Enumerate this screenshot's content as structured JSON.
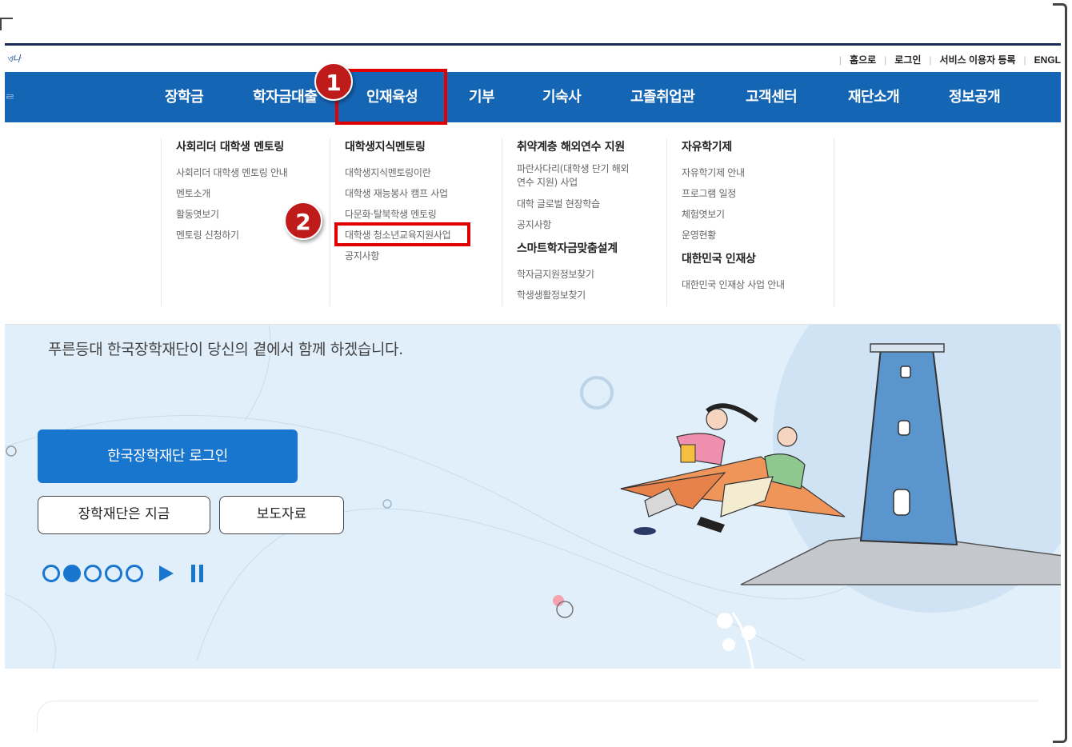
{
  "util_links": [
    "홈으로",
    "로그인",
    "서비스 이용자 등록",
    "ENGL"
  ],
  "logo_fragment": "ଏ나",
  "gnb": {
    "left_fragment": "ᄅ",
    "items": [
      "장학금",
      "학자금대출",
      "인재육성",
      "기부",
      "기숙사",
      "고졸취업관",
      "고객센터",
      "재단소개",
      "정보공개"
    ]
  },
  "mega": {
    "col1": {
      "title": "사회리더 대학생 멘토링",
      "links": [
        "사회리더 대학생 멘토링 안내",
        "멘토소개",
        "활동엿보기",
        "멘토링 신청하기"
      ]
    },
    "col2": {
      "title": "대학생지식멘토링",
      "links": [
        "대학생지식멘토링이란",
        "대학생 재능봉사 캠프 사업",
        "다문화·탈북학생 멘토링",
        "대학생 청소년교육지원사업",
        "공지사항"
      ]
    },
    "col3": {
      "title": "취약계층 해외연수 지원",
      "links": [
        "파란사다리(대학생 단기 해외연수 지원) 사업",
        "대학 글로벌 현장학습",
        "공지사항"
      ],
      "title2": "스마트학자금맞춤설계",
      "links2": [
        "학자금지원정보찾기",
        "학생생활정보찾기"
      ]
    },
    "col4": {
      "title": "자유학기제",
      "links": [
        "자유학기제 안내",
        "프로그램 일정",
        "체험엿보기",
        "운영현황"
      ],
      "title2": "대한민국 인재상",
      "links2": [
        "대한민국 인재상 사업 안내"
      ]
    }
  },
  "hero": {
    "tagline": "푸른등대 한국장학재단이 당신의 곁에서 함께 하겠습니다.",
    "login_button": "한국장학재단 로그인",
    "button_now": "장학재단은 지금",
    "button_press": "보도자료",
    "slider": {
      "total": 5,
      "active": 2
    }
  },
  "callouts": {
    "step1": "1",
    "step2": "2"
  },
  "colors": {
    "gnb_blue": "#1565b5",
    "callout_red": "#e00000",
    "badge_red": "#bf1b1b",
    "hero_bg": "#e1effb",
    "accent": "#1976cf"
  }
}
